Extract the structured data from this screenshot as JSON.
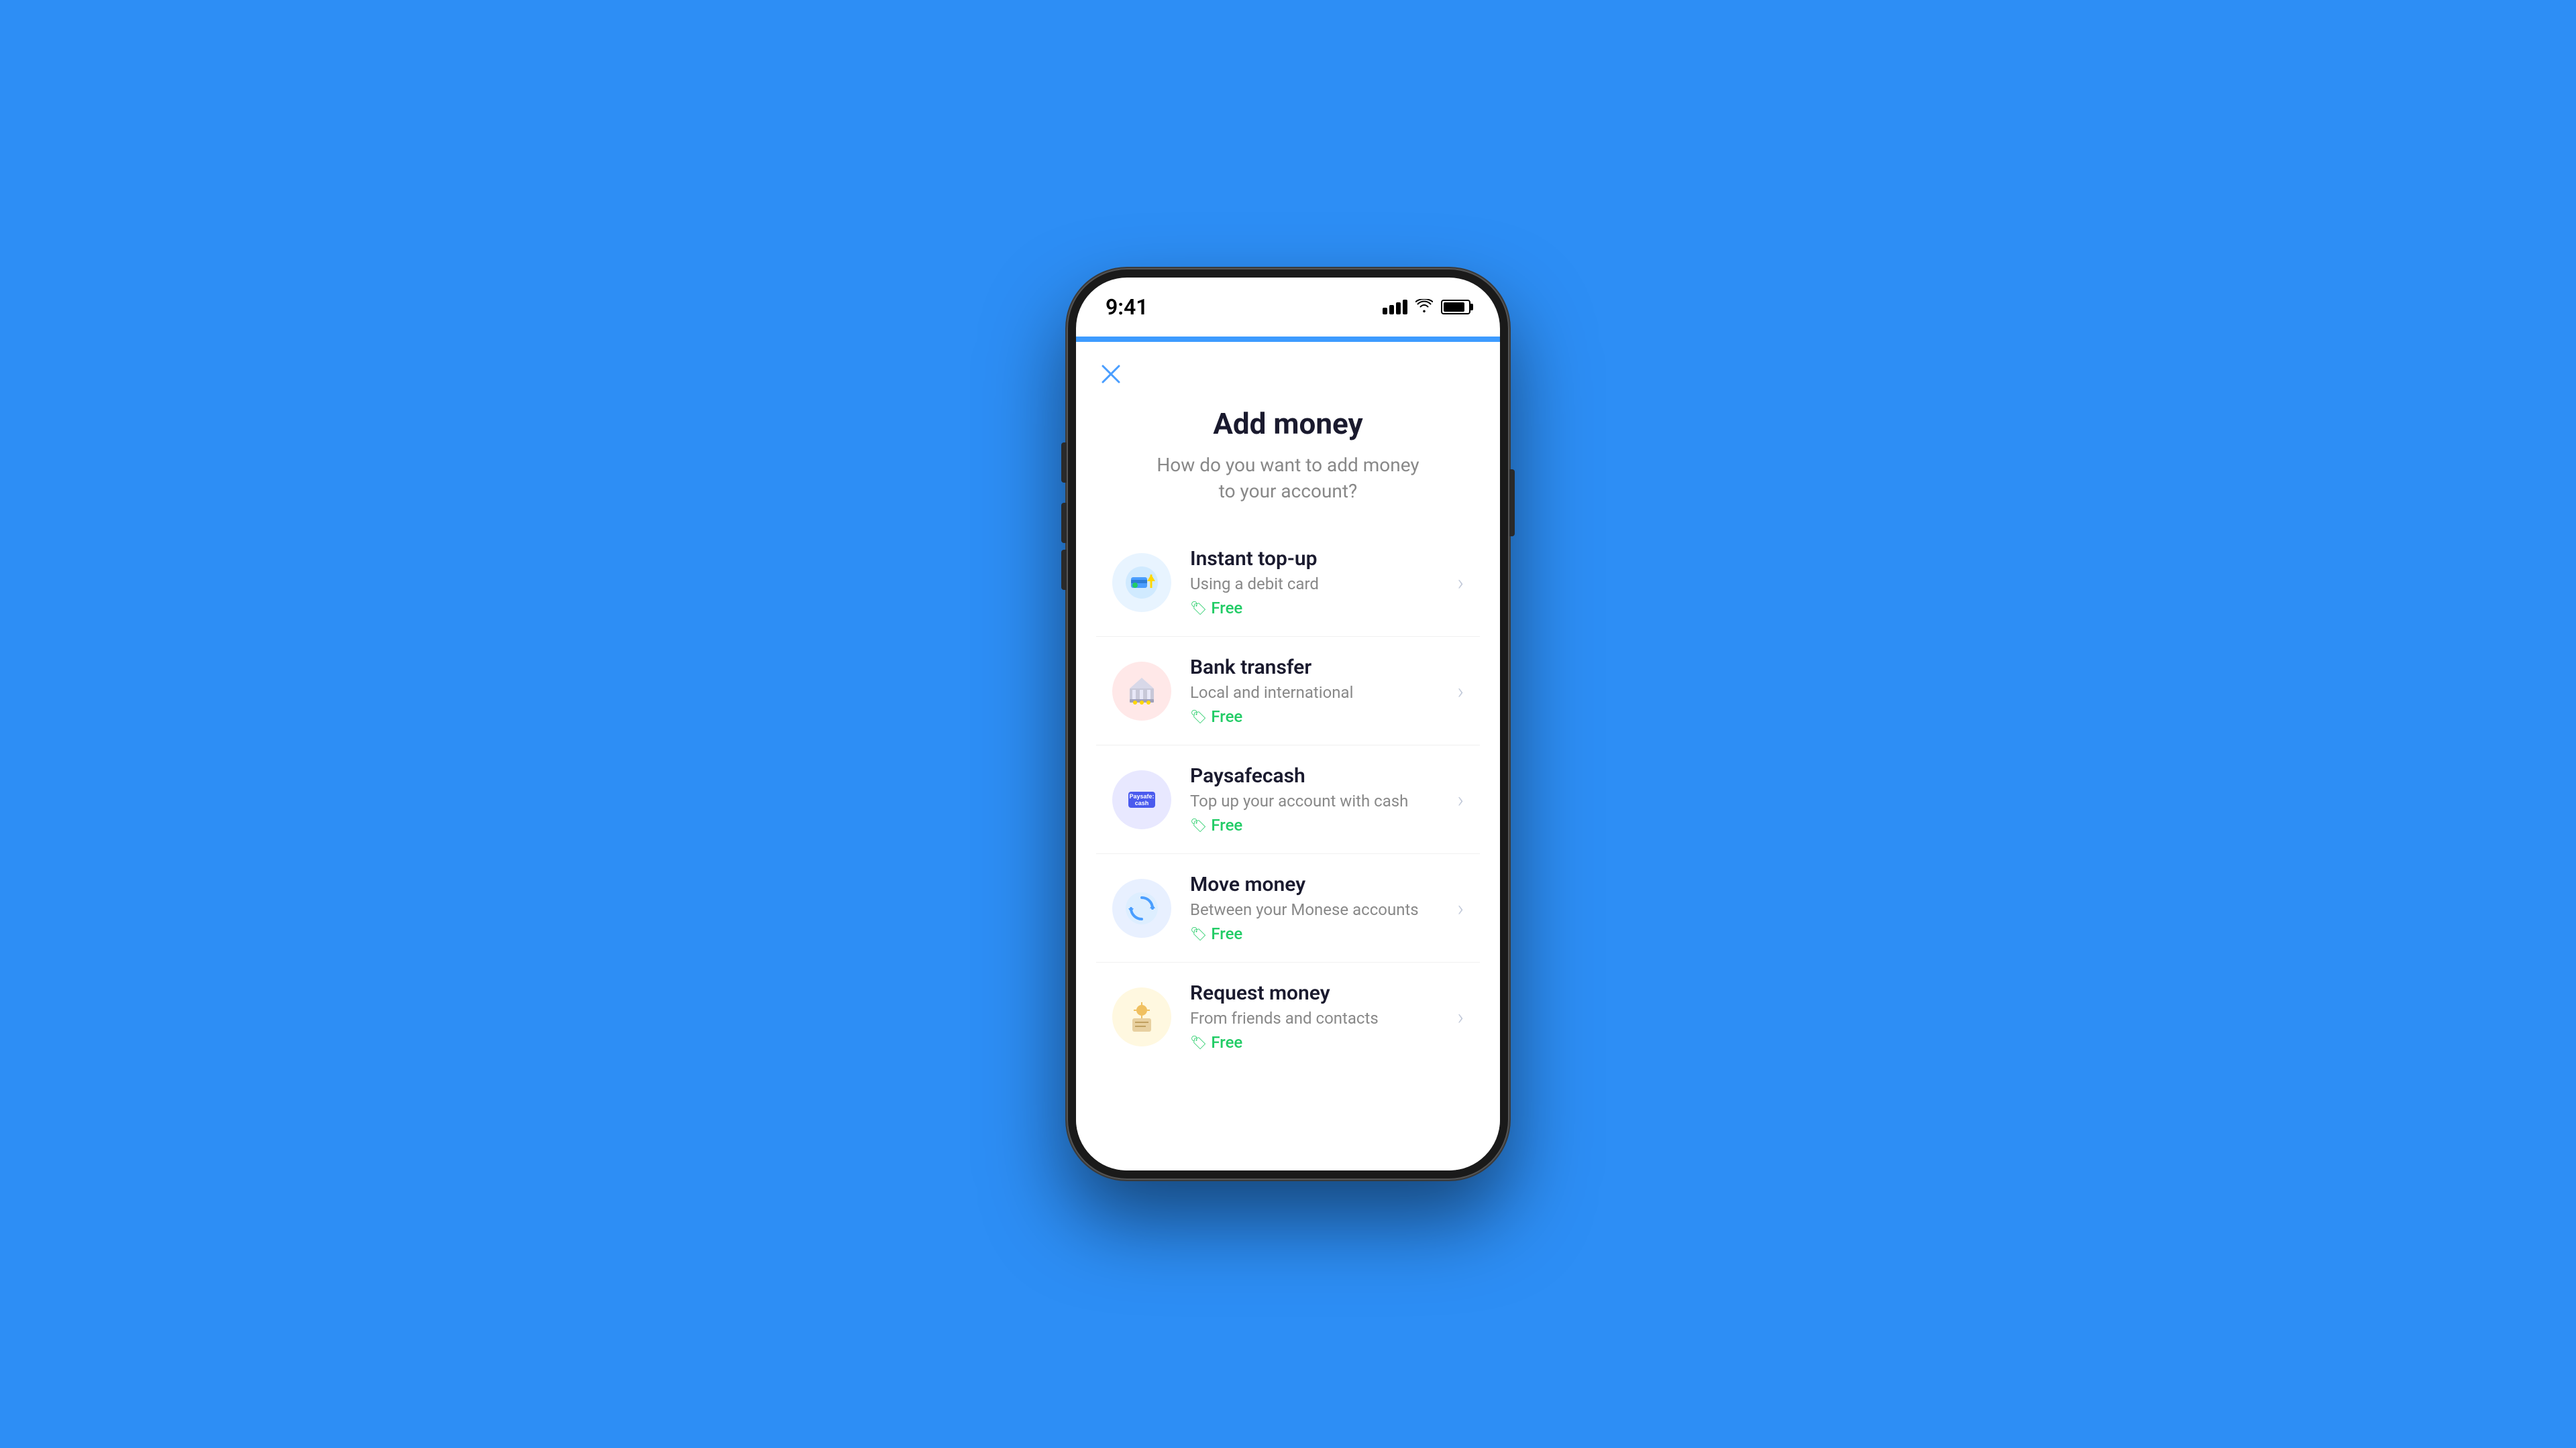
{
  "background_color": "#2d8ef5",
  "phone": {
    "status_bar": {
      "time": "9:41",
      "signal_label": "signal",
      "wifi_label": "wifi",
      "battery_label": "battery"
    },
    "accent_bar_color": "#3d9bff",
    "screen": {
      "close_button_label": "×",
      "title": "Add money",
      "subtitle": "How do you want to add money\nto your account?",
      "menu_items": [
        {
          "id": "instant-topup",
          "title": "Instant top-up",
          "subtitle": "Using a debit card",
          "badge": "Free",
          "icon_type": "instant"
        },
        {
          "id": "bank-transfer",
          "title": "Bank transfer",
          "subtitle": "Local and international",
          "badge": "Free",
          "icon_type": "bank"
        },
        {
          "id": "paysafecash",
          "title": "Paysafecash",
          "subtitle": "Top up your account with cash",
          "badge": "Free",
          "icon_type": "paysafe"
        },
        {
          "id": "move-money",
          "title": "Move money",
          "subtitle": "Between your Monese accounts",
          "badge": "Free",
          "icon_type": "move"
        },
        {
          "id": "request-money",
          "title": "Request money",
          "subtitle": "From friends and contacts",
          "badge": "Free",
          "icon_type": "request"
        }
      ]
    }
  }
}
